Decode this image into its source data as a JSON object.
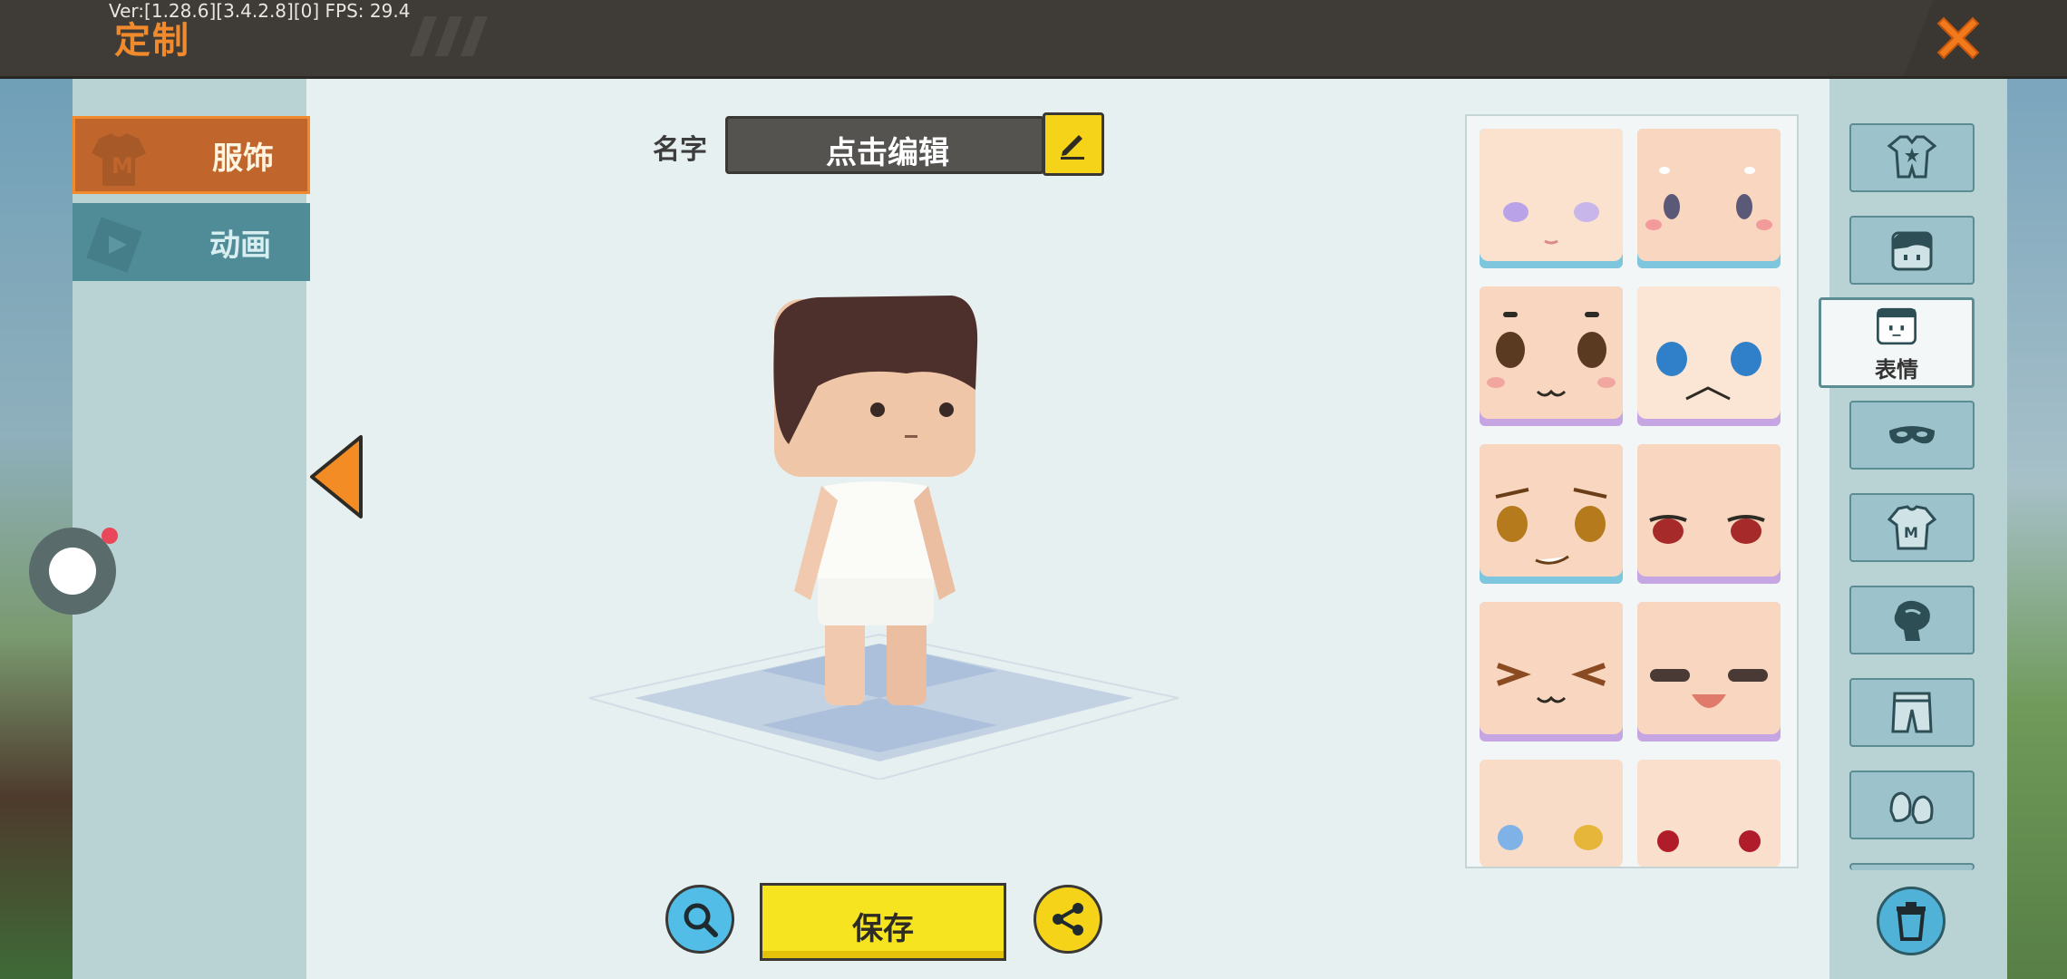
{
  "debug": "Ver:[1.28.6][3.4.2.8][0] FPS: 29.4",
  "header": {
    "title": "定制"
  },
  "left_tabs": [
    {
      "label": "服饰",
      "icon": "shirt-icon"
    },
    {
      "label": "动画",
      "icon": "play-icon"
    }
  ],
  "name": {
    "label": "名字",
    "value": "点击编辑"
  },
  "buttons": {
    "save": "保存",
    "zoom": "zoom-icon",
    "share": "share-icon",
    "trash": "trash-icon",
    "close": "close-icon"
  },
  "faces": [
    "face-purple-eyes",
    "face-dot-eyes",
    "face-brown-eyes",
    "face-blue-crying-eyes",
    "face-amber-eyes",
    "face-red-sleepy-eyes",
    "face-squint-happy",
    "face-sparkle-grin",
    "face-heterochromia",
    "face-red-eyes"
  ],
  "categories": [
    {
      "icon": "onesie-icon"
    },
    {
      "icon": "hair-icon"
    },
    {
      "icon": "expression-icon",
      "label": "表情",
      "active": true
    },
    {
      "icon": "mask-icon"
    },
    {
      "icon": "tshirt-icon"
    },
    {
      "icon": "glove-icon"
    },
    {
      "icon": "pants-icon"
    },
    {
      "icon": "shoes-icon"
    }
  ],
  "colors": {
    "accent": "#f08a2c",
    "yellow": "#f5d319",
    "panel": "#e7f0f0",
    "teal": "#4f8c98"
  }
}
